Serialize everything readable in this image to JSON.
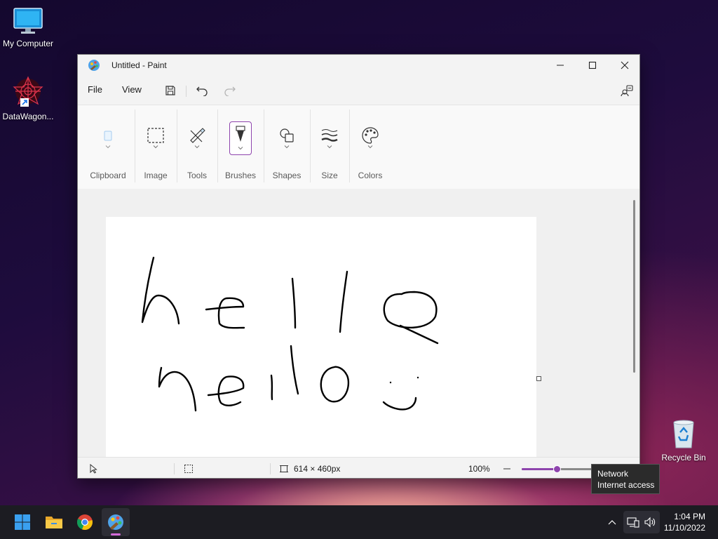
{
  "desktop": {
    "icons": [
      {
        "label": "My Computer"
      },
      {
        "label": "DataWagon..."
      },
      {
        "label": "Recycle Bin"
      }
    ]
  },
  "window": {
    "title": "Untitled - Paint",
    "menu": {
      "file": "File",
      "view": "View"
    },
    "ribbon": {
      "groups": [
        "Clipboard",
        "Image",
        "Tools",
        "Brushes",
        "Shapes",
        "Size",
        "Colors"
      ]
    },
    "status": {
      "canvas_size": "614 × 460px",
      "zoom": "100%",
      "zoom_slider_fraction": 0.5
    }
  },
  "tooltip": {
    "line1": "Network",
    "line2": "Internet access"
  },
  "taskbar": {
    "time": "1:04 PM",
    "date": "11/10/2022",
    "apps": [
      "start-icon",
      "file-explorer-icon",
      "chrome-icon",
      "paint-icon"
    ]
  },
  "colors": {
    "accent": "#8e44ad",
    "taskbar": "#1c1c22"
  }
}
